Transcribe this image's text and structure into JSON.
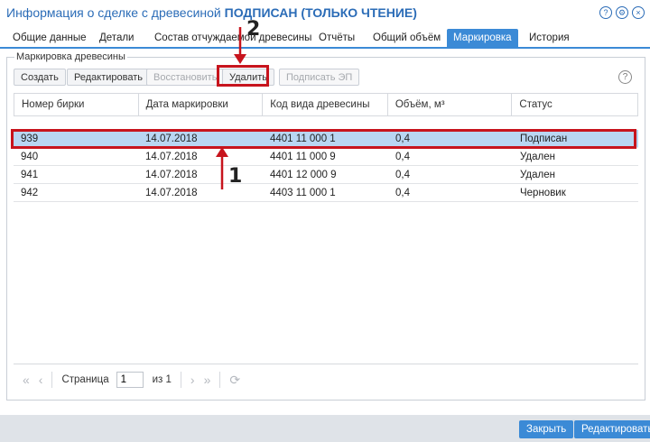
{
  "window": {
    "title_prefix": "Информация о сделке с древесиной",
    "title_status": "ПОДПИСАН",
    "title_mode": "(ТОЛЬКО ЧТЕНИЕ)",
    "icons": [
      "help-icon",
      "gear-icon",
      "close-icon"
    ]
  },
  "tabs": [
    {
      "label": "Общие данные"
    },
    {
      "label": "Детали"
    },
    {
      "label": "Состав отчуждаемой древесины"
    },
    {
      "label": "Отчёты"
    },
    {
      "label": "Общий объём"
    },
    {
      "label": "Маркировка",
      "active": true
    },
    {
      "label": "История"
    }
  ],
  "panel": {
    "legend": "Маркировка древесины",
    "toolbar": {
      "create": "Создать",
      "edit": "Редактировать",
      "restore": "Восстановить",
      "delete": "Удалить",
      "sign": "Подписать ЭП"
    }
  },
  "table": {
    "columns": [
      "Номер бирки",
      "Дата маркировки",
      "Код вида древесины",
      "Объём, м³",
      "Статус"
    ],
    "rows": [
      [
        "939",
        "14.07.2018",
        "4401 11 000 1",
        "0,4",
        "Подписан"
      ],
      [
        "940",
        "14.07.2018",
        "4401 11 000 9",
        "0,4",
        "Удален"
      ],
      [
        "941",
        "14.07.2018",
        "4401 12 000 9",
        "0,4",
        "Удален"
      ],
      [
        "942",
        "14.07.2018",
        "4403 11 000 1",
        "0,4",
        "Черновик"
      ]
    ],
    "selected_row": 0
  },
  "pager": {
    "page_label": "Страница",
    "page_value": "1",
    "of_label": "из 1"
  },
  "footer": {
    "close": "Закрыть",
    "edit": "Редактировать"
  },
  "annotations": {
    "n1": "1",
    "n2": "2",
    "color": "#c7141d"
  }
}
